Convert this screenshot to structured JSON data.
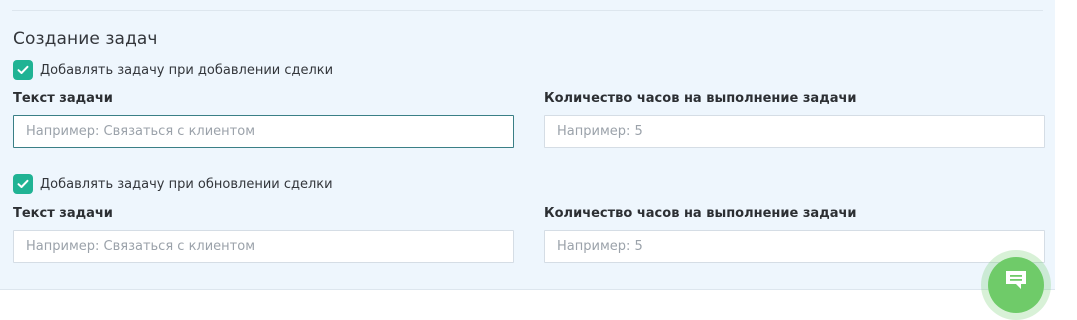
{
  "section": {
    "title": "Создание задач"
  },
  "on_create": {
    "checkbox_label": "Добавлять задачу при добавлении сделки",
    "checked": true,
    "task_text_label": "Текст задачи",
    "task_text_placeholder": "Например: Связаться с клиентом",
    "hours_label": "Количество часов на выполнение задачи",
    "hours_placeholder": "Например: 5"
  },
  "on_update": {
    "checkbox_label": "Добавлять задачу при обновлении сделки",
    "checked": true,
    "task_text_label": "Текст задачи",
    "task_text_placeholder": "Например: Связаться с клиентом",
    "hours_label": "Количество часов на выполнение задачи",
    "hours_placeholder": "Например: 5"
  },
  "icons": {
    "checkbox": "check-icon",
    "chat_button": "chat-icon"
  },
  "colors": {
    "panel_background": "#eef6fd",
    "checkbox_accent": "#20b394",
    "focused_border": "#3a7f86",
    "chat_button": "#6fcb69"
  }
}
